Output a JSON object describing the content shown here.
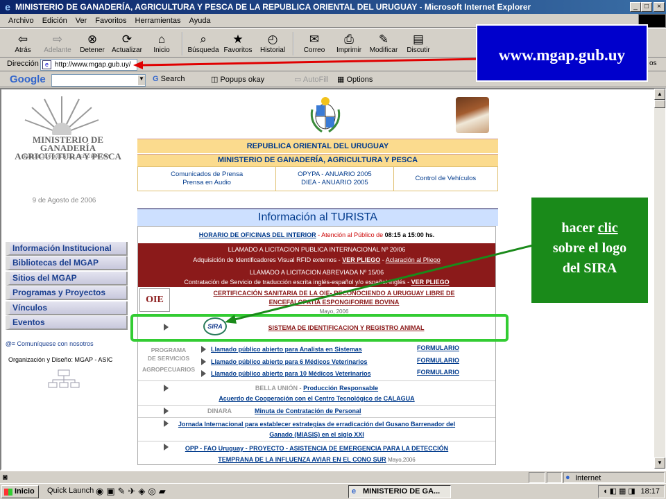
{
  "window": {
    "title": "MINISTERIO DE GANADERÍA, AGRICULTURA Y PESCA DE LA REPUBLICA ORIENTAL DEL URUGUAY - Microsoft Internet Explorer",
    "minimize": "_",
    "maximize": "□",
    "close": "×"
  },
  "menubar": [
    "Archivo",
    "Edición",
    "Ver",
    "Favoritos",
    "Herramientas",
    "Ayuda"
  ],
  "toolbar": {
    "buttons": [
      {
        "label": "Atrás",
        "icon": "back-arrow-icon"
      },
      {
        "label": "Adelante",
        "icon": "forward-arrow-icon"
      },
      {
        "label": "Detener",
        "icon": "stop-icon"
      },
      {
        "label": "Actualizar",
        "icon": "refresh-icon"
      },
      {
        "label": "Inicio",
        "icon": "home-icon"
      },
      {
        "label": "Búsqueda",
        "icon": "search-icon"
      },
      {
        "label": "Favoritos",
        "icon": "favorites-icon"
      },
      {
        "label": "Historial",
        "icon": "history-icon"
      },
      {
        "label": "Correo",
        "icon": "mail-icon"
      },
      {
        "label": "Imprimir",
        "icon": "print-icon"
      },
      {
        "label": "Modificar",
        "icon": "edit-icon"
      },
      {
        "label": "Discutir",
        "icon": "discuss-icon"
      }
    ]
  },
  "address": {
    "label": "Dirección",
    "value": "http://www.mgap.gub.uy/",
    "links_suffix": "os"
  },
  "google": {
    "logo": "Google",
    "search": "Search",
    "popups": "Popups okay",
    "autofill": "AutoFill",
    "options": "Options"
  },
  "status": {
    "zone": "Internet"
  },
  "taskbar": {
    "start": "Inicio",
    "quick_launch": "Quick Launch",
    "task": "MINISTERIO DE GA...",
    "time": "18:17"
  },
  "page": {
    "logo_line1": "MINISTERIO DE GANADERÍA",
    "logo_line2": "AGRICULTURA Y PESCA",
    "logo_line3": "REPÚBLICA ORIENTAL DEL URUGUAY",
    "date": "9 de Agosto de 2006",
    "left_menu": [
      "Información Institucional",
      "Bibliotecas del MGAP",
      "Sitios del MGAP",
      "Programas y Proyectos",
      "Vínculos",
      "Eventos"
    ],
    "contact": "Comuníquese con nosotros",
    "org_design": "Organización y Diseño: MGAP - ASIC",
    "band1": "REPUBLICA ORIENTAL DEL URUGUAY",
    "band2": "MINISTERIO DE GANADERÍA, AGRICULTURA Y PESCA",
    "band3": {
      "col1_l1": "Comunicados de Prensa",
      "col1_l2": "Prensa en Audio",
      "col2_l1": "OPYPA - ANUARIO 2005",
      "col2_l2": "DIEA - ANUARIO 2005",
      "col3": "Control de Vehículos"
    },
    "info_turista": "Información al TURISTA",
    "horario": {
      "link": "HORARIO DE OFICINAS DEL INTERIOR",
      "rest": " - Atención al Público de ",
      "hours": "08:15 a 15:00 hs."
    },
    "llamado1": {
      "title": "LLAMADO A LICITACION PUBLICA INTERNACIONAL Nº 20/06",
      "desc": "Adquisición de Identificadores Visual RFID externos - ",
      "pliego": "VER PLIEGO",
      "sep": " - ",
      "aclaracion": "Aclaración al Pliego"
    },
    "llamado2": {
      "title": "LLAMADO A LICITACION ABREVIADA Nº 15/06",
      "desc": "Contratación de Servicio de traducción escrita inglés-español y/o español-inglés - ",
      "pliego": "VER PLIEGO"
    },
    "oie": {
      "logo": "OIE",
      "line1": "CERTIFICACIÓN SANITARIA DE LA OIE- RECONOCIENDO A URUGUAY LIBRE DE",
      "line2": "ENCEFALOPATÍA ESPONGIFORME BOVINA",
      "date": "Mayo, 2006"
    },
    "sira": {
      "logo": "SIRA",
      "link": "SISTEMA DE IDENTIFICACION Y REGISTRO ANIMAL"
    },
    "prosa": {
      "label1": "PROGRAMA",
      "label2": "DE SERVICIOS",
      "label3": "AGROPECUARIOS",
      "links": [
        "Llamado público abierto para Analista en Sistemas",
        "Llamado público abierto para 6 Médicos Veterinarios",
        "Llamado público abierto para 10 Médicos Veterinarios"
      ],
      "form": "FORMULARIO"
    },
    "bella": {
      "label": "BELLA UNIÓN - ",
      "link": "Producción Responsable",
      "line2": "Acuerdo de Cooperación con el Centro Tecnológico de CALAGUA"
    },
    "dinara": {
      "label": "DINARA",
      "link": "Minuta de Contratación de Personal"
    },
    "jornada": {
      "line1": "Jornada Internacional para establecer estrategias de erradicación del Gusano Barrenador del",
      "line2": "Ganado (MIASIS) en el siglo XXI"
    },
    "opp": {
      "line1": "OPP - FAO Uruguay - PROYECTO - ASISTENCIA DE EMERGENCIA PARA LA DETECCIÓN",
      "line2": "TEMPRANA DE LA INFLUENZA AVIAR EN EL CONO SUR",
      "date": "Mayo,2006"
    }
  },
  "callouts": {
    "url": "www.mgap.gub.uy",
    "sira_l1a": "hacer ",
    "sira_l1b": "clic",
    "sira_l2": "sobre el logo",
    "sira_l3": "del SIRA"
  },
  "colors": {
    "title_gradient_start": "#0a246a",
    "band_yellow": "#fbdb8e",
    "dark_red": "#8b1a1a",
    "callout_blue": "#0000cc",
    "callout_green": "#1a8a1a",
    "highlight_green": "#33cc33",
    "arrow_red": "#e00000"
  }
}
